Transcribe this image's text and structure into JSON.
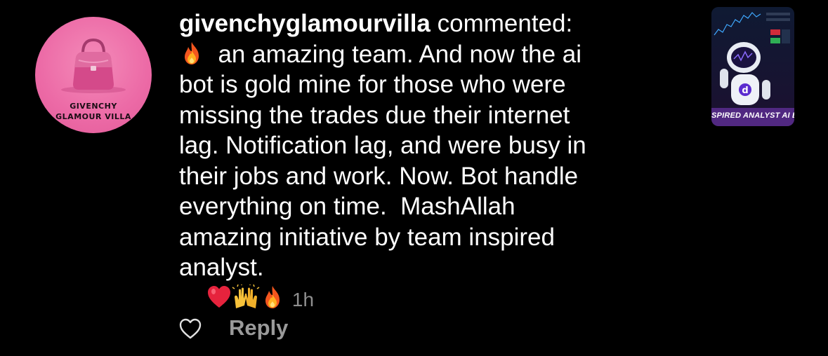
{
  "avatar": {
    "brand_line1": "GIVENCHY",
    "brand_line2": "GLAMOUR VILLA",
    "bg_color": "#ec6aa6"
  },
  "comment": {
    "username": "givenchyglamourvilla",
    "action": "commented:",
    "lines": [
      "an amazing team. And now the ai",
      "bot is gold mine for those who were",
      "missing the trades due their internet",
      "lag. Notification lag, and were busy in",
      "their jobs and work. Now. Bot handle",
      "everything on time.  MashAllah",
      "amazing initiative by team inspired",
      "analyst."
    ],
    "lead_emoji": "fire-emoji",
    "trailing_emojis": [
      "red-heart-emoji",
      "raising-hands-emoji",
      "fire-emoji"
    ],
    "time": "1h"
  },
  "post_thumbnail": {
    "caption": "SPIRED ANALYST AI B",
    "icon": "robot-icon"
  },
  "actions": {
    "like_icon": "heart-outline-icon",
    "reply_label": "Reply"
  },
  "colors": {
    "background": "#000000",
    "text": "#ffffff",
    "muted": "#8e8e8e"
  }
}
